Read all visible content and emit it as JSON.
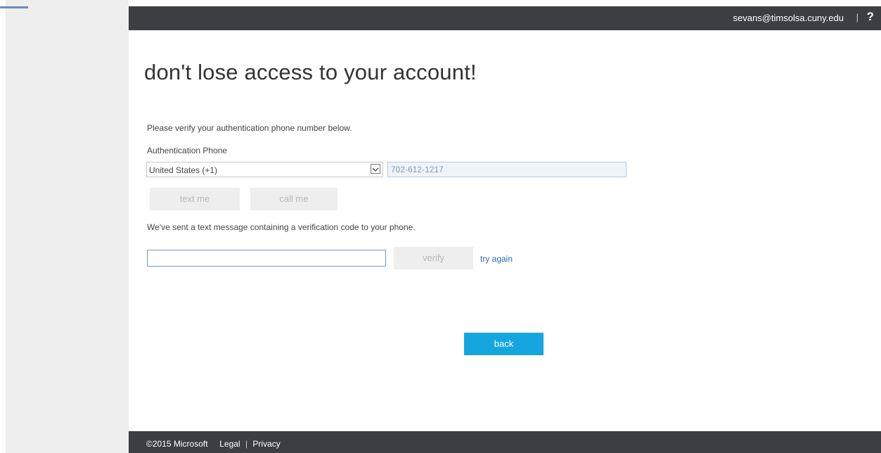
{
  "header": {
    "user_email": "sevans@timsolsa.cuny.edu",
    "separator": "|",
    "help_label": "?"
  },
  "main": {
    "title": "don't lose access to your account!",
    "instruction": "Please verify your authentication phone number below.",
    "phone_label": "Authentication Phone",
    "country_value": "United States (+1)",
    "phone_number": "702-612-1217",
    "text_me_label": "text me",
    "call_me_label": "call me",
    "sent_message": "We've sent a text message containing a verification code to your phone.",
    "code_value": "",
    "verify_label": "verify",
    "try_again_label": "try again",
    "back_label": "back"
  },
  "footer": {
    "copyright": "©2015 Microsoft",
    "legal_label": "Legal",
    "separator": "|",
    "privacy_label": "Privacy"
  },
  "colors": {
    "header_bg": "#3b3e43",
    "accent_button": "#16a6df",
    "link": "#2a6ab3",
    "sidebar_bg": "#eeeeee"
  },
  "icons": {
    "dropdown": "chevron-down-icon",
    "help": "help-icon"
  }
}
